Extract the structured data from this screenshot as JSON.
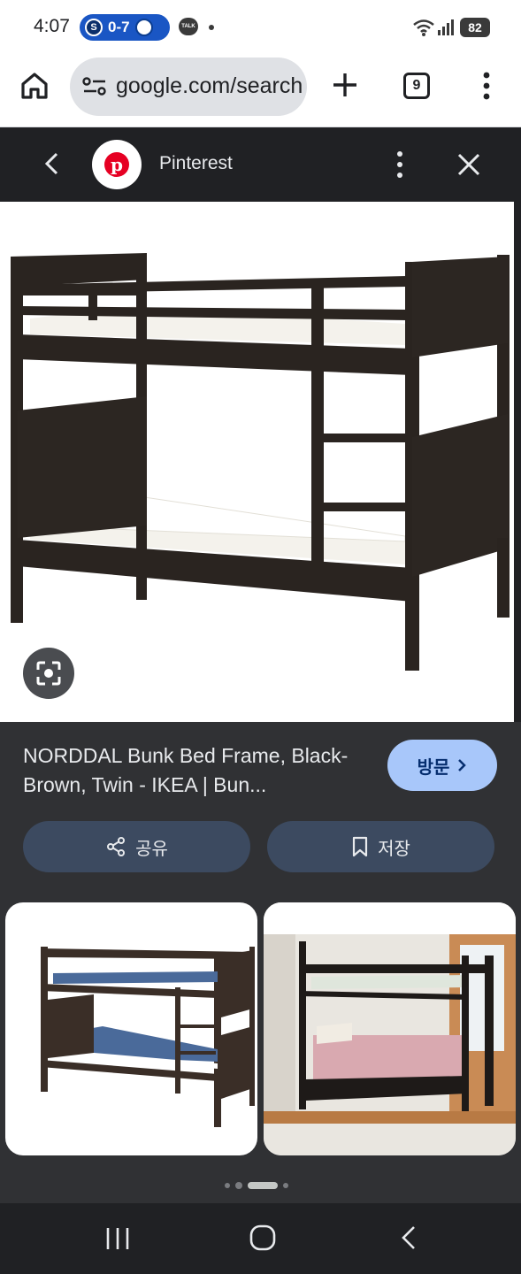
{
  "status_bar": {
    "time": "4:07",
    "score": "0-7",
    "talk_label": "TALK",
    "battery": "82"
  },
  "browser": {
    "url_text": "google.com/search",
    "tab_count": "9"
  },
  "source": {
    "name": "Pinterest"
  },
  "result": {
    "title": "NORDDAL Bunk Bed Frame, Black-Brown, Twin - IKEA | Bun...",
    "visit_label": "방문",
    "share_label": "공유",
    "save_label": "저장"
  },
  "colors": {
    "bed_frame": "#2a2420",
    "accent_visit": "#a8c7fa",
    "pinterest_red": "#e60023"
  }
}
